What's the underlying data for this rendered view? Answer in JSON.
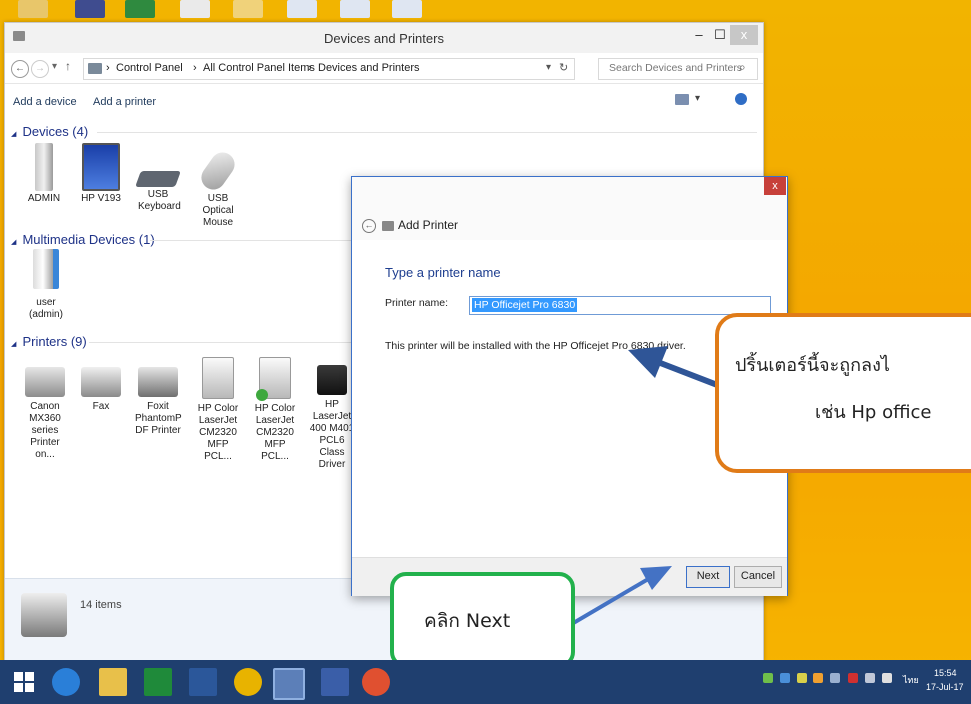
{
  "window": {
    "title": "Devices and Printers",
    "minimize": "–",
    "maximize": "☐",
    "close": "x",
    "back_icon": "←",
    "forward_icon": "→",
    "up_icon": "↑",
    "breadcrumb": [
      "Control Panel",
      "All Control Panel Items",
      "Devices and Printers"
    ],
    "separator": "›",
    "search_placeholder": "Search Devices and Printers",
    "search_icon": "⌕",
    "refresh_icon": "↻",
    "dropdown_icon": "▾"
  },
  "toolbar": {
    "add_device": "Add a device",
    "add_printer": "Add a printer"
  },
  "sections": {
    "devices": "Devices (4)",
    "multimedia": "Multimedia Devices (1)",
    "printers": "Printers (9)",
    "collapse_icon": "◢"
  },
  "devices": [
    {
      "label": "ADMIN",
      "icon": "computer-tower-icon"
    },
    {
      "label": "HP V193",
      "icon": "monitor-icon"
    },
    {
      "label": "USB Keyboard",
      "icon": "keyboard-icon"
    },
    {
      "label": "USB Optical Mouse",
      "icon": "mouse-icon"
    }
  ],
  "multimedia": [
    {
      "label": "user (admin)",
      "icon": "media-device-icon"
    }
  ],
  "printers": [
    {
      "label": "Canon MX360 series Printer on...",
      "icon": "printer-icon"
    },
    {
      "label": "Fax",
      "icon": "fax-icon"
    },
    {
      "label": "Foxit PhantomP DF Printer",
      "icon": "printer-icon"
    },
    {
      "label": "HP Color LaserJet CM2320 MFP PCL...",
      "icon": "mfp-printer-icon"
    },
    {
      "label": "HP Color LaserJet CM2320 MFP PCL...",
      "icon": "mfp-printer-default-icon"
    },
    {
      "label": "HP LaserJet 400 M401 PCL6 Class Driver",
      "icon": "laser-printer-icon"
    }
  ],
  "details": {
    "count": "14 items"
  },
  "dialog": {
    "title": "Add Printer",
    "close": "x",
    "heading": "Type a printer name",
    "field_label": "Printer name:",
    "field_value": "HP Officejet Pro 6830",
    "info": "This printer will be installed with the HP Officejet Pro 6830 driver.",
    "next": "Next",
    "cancel": "Cancel"
  },
  "callouts": {
    "orange_line1": "ปริ้นเตอร์นี้จะถูกลงไ",
    "orange_line2": "เช่น Hp office",
    "green_text": "คลิก Next"
  },
  "taskbar": {
    "language": "ไทย",
    "time": "15:54",
    "date": "17-Jul-17"
  },
  "colors": {
    "desktop": "#f4a500",
    "orange_callout": "#e07b18",
    "green_callout": "#22b14c",
    "arrow": "#2f5597",
    "selection": "#3399ff",
    "taskbar": "#1f3f6f"
  }
}
